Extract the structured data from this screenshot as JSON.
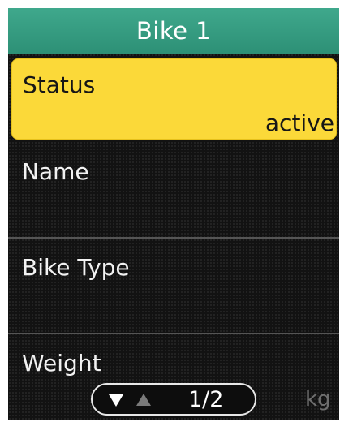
{
  "header": {
    "title": "Bike 1"
  },
  "rows": [
    {
      "label": "Status",
      "value": "active",
      "selected": true
    },
    {
      "label": "Name"
    },
    {
      "label": "Bike Type"
    },
    {
      "label": "Weight",
      "unit": "kg"
    }
  ],
  "pager": {
    "indicator": "1/2",
    "down_icon": "triangle-down",
    "up_icon": "triangle-up"
  },
  "colors": {
    "title_bar": "#2d9076",
    "selected_row": "#fbd939",
    "background": "#121212"
  }
}
